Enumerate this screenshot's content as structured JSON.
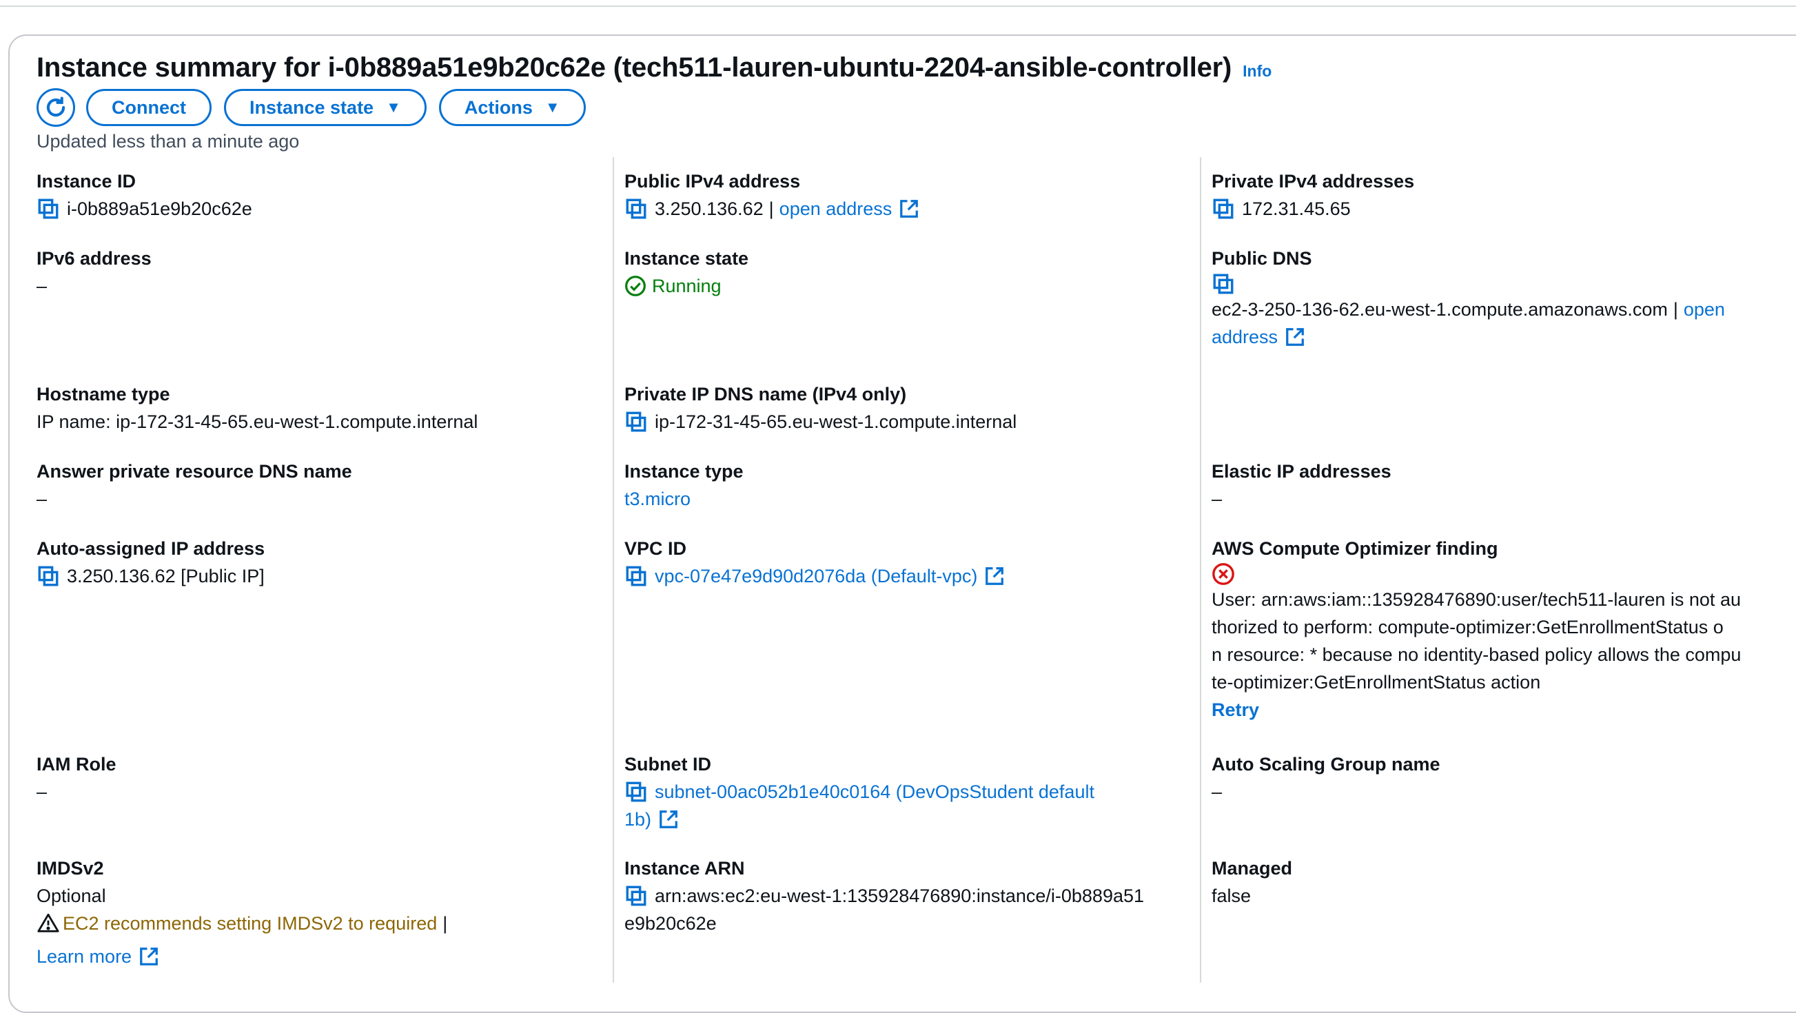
{
  "header": {
    "title": "Instance summary for i-0b889a51e9b20c62e (tech511-lauren-ubuntu-2204-ansible-controller)",
    "info": "Info",
    "updated": "Updated less than a minute ago"
  },
  "buttons": {
    "connect": "Connect",
    "instance_state": "Instance state",
    "actions": "Actions"
  },
  "col1": {
    "instance_id": {
      "label": "Instance ID",
      "value": "i-0b889a51e9b20c62e"
    },
    "ipv6": {
      "label": "IPv6 address",
      "value": "–"
    },
    "hostname_type": {
      "label": "Hostname type",
      "value": "IP name: ip-172-31-45-65.eu-west-1.compute.internal"
    },
    "answer_dns": {
      "label": "Answer private resource DNS name",
      "value": "–"
    },
    "auto_ip": {
      "label": "Auto-assigned IP address",
      "value": "3.250.136.62 [Public IP]"
    },
    "iam_role": {
      "label": "IAM Role",
      "value": "–"
    },
    "imdsv2": {
      "label": "IMDSv2",
      "value": "Optional",
      "warning": "EC2 recommends setting IMDSv2 to required",
      "separator": "|",
      "learn_more": "Learn more"
    }
  },
  "col2": {
    "public_ipv4": {
      "label": "Public IPv4 address",
      "value": "3.250.136.62",
      "separator": "|",
      "link": "open address"
    },
    "instance_state": {
      "label": "Instance state",
      "value": "Running"
    },
    "private_dns": {
      "label": "Private IP DNS name (IPv4 only)",
      "value": "ip-172-31-45-65.eu-west-1.compute.internal"
    },
    "instance_type": {
      "label": "Instance type",
      "value": "t3.micro"
    },
    "vpc_id": {
      "label": "VPC ID",
      "value": "vpc-07e47e9d90d2076da (Default-vpc)"
    },
    "subnet_id": {
      "label": "Subnet ID",
      "value_line1": "subnet-00ac052b1e40c0164 (DevOpsStudent default",
      "value_line2": "1b)"
    },
    "instance_arn": {
      "label": "Instance ARN",
      "value_line1": "arn:aws:ec2:eu-west-1:135928476890:instance/i-0b889a51",
      "value_line2": "e9b20c62e"
    }
  },
  "col3": {
    "private_ipv4": {
      "label": "Private IPv4 addresses",
      "value": "172.31.45.65"
    },
    "public_dns": {
      "label": "Public DNS",
      "value": "ec2-3-250-136-62.eu-west-1.compute.amazonaws.com",
      "separator": "|",
      "link1": "open",
      "link2": "address"
    },
    "elastic_ip": {
      "label": "Elastic IP addresses",
      "value": "–"
    },
    "optimizer": {
      "label": "AWS Compute Optimizer finding",
      "line1": "User: arn:aws:iam::135928476890:user/tech511-lauren is not au",
      "line2": "thorized to perform: compute-optimizer:GetEnrollmentStatus o",
      "line3": "n resource: * because no identity-based policy allows the compu",
      "line4": "te-optimizer:GetEnrollmentStatus action",
      "retry": "Retry"
    },
    "asg": {
      "label": "Auto Scaling Group name",
      "value": "–"
    },
    "managed": {
      "label": "Managed",
      "value": "false"
    }
  },
  "colors": {
    "link": "#0972d3",
    "running": "#037f0c",
    "warning": "#8d6605",
    "error": "#d91515"
  }
}
